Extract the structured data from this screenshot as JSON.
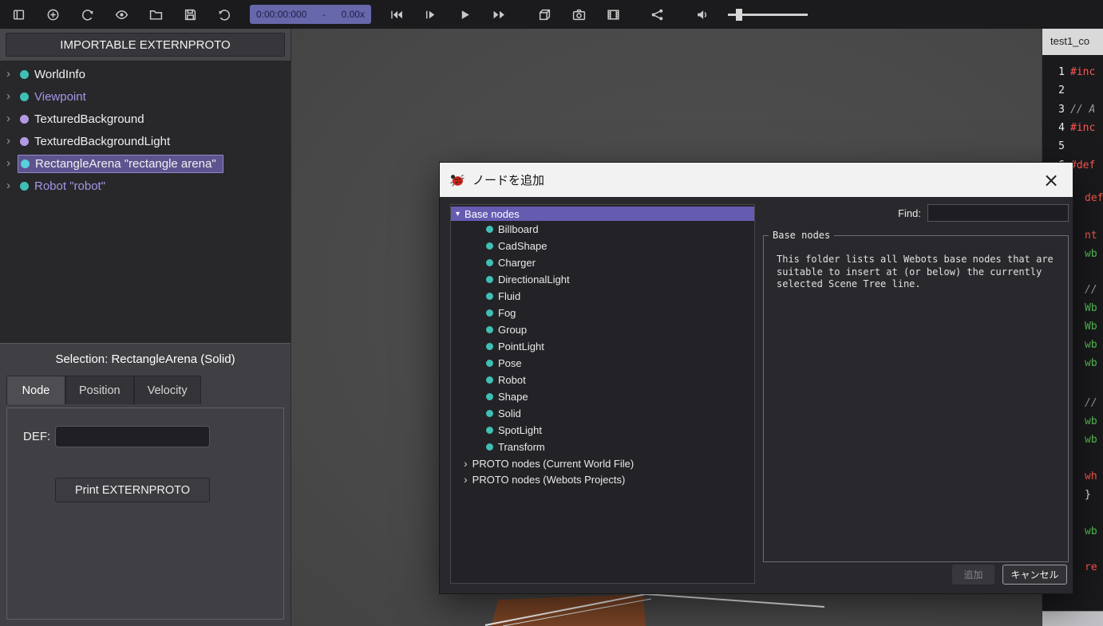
{
  "toolbar": {
    "time_value": "0:00:00:000",
    "time_separator": "-",
    "speed_value": "0.00x"
  },
  "icons": {
    "chevron_right": "›",
    "chevron_down": "▾",
    "close": "×"
  },
  "scene_tree": {
    "header_button": "IMPORTABLE EXTERNPROTO",
    "items": [
      {
        "label": "WorldInfo"
      },
      {
        "label": "Viewpoint"
      },
      {
        "label": "TexturedBackground"
      },
      {
        "label": "TexturedBackgroundLight"
      },
      {
        "label": "RectangleArena \"rectangle arena\""
      },
      {
        "label": "Robot \"robot\""
      }
    ]
  },
  "selection_panel": {
    "title": "Selection: RectangleArena (Solid)",
    "tabs": [
      {
        "label": "Node"
      },
      {
        "label": "Position"
      },
      {
        "label": "Velocity"
      }
    ],
    "def_label": "DEF:",
    "def_value": "",
    "print_button": "Print EXTERNPROTO"
  },
  "add_node_dialog": {
    "title": "ノードを追加",
    "tree": {
      "root_label": "Base nodes",
      "base_nodes": [
        {
          "label": "Billboard"
        },
        {
          "label": "CadShape"
        },
        {
          "label": "Charger"
        },
        {
          "label": "DirectionalLight"
        },
        {
          "label": "Fluid"
        },
        {
          "label": "Fog"
        },
        {
          "label": "Group"
        },
        {
          "label": "PointLight"
        },
        {
          "label": "Pose"
        },
        {
          "label": "Robot"
        },
        {
          "label": "Shape"
        },
        {
          "label": "Solid"
        },
        {
          "label": "SpotLight"
        },
        {
          "label": "Transform"
        }
      ],
      "proto_groups": [
        {
          "label": "PROTO nodes (Current World File)"
        },
        {
          "label": "PROTO nodes (Webots Projects)"
        }
      ]
    },
    "find_label": "Find:",
    "find_value": "",
    "info_box": {
      "title": "Base nodes",
      "text": "This folder lists all Webots base nodes that are suitable to insert at (or below) the currently selected Scene Tree line."
    },
    "add_button": "追加",
    "cancel_button": "キャンセル"
  },
  "editor": {
    "tab_label": "test1_co",
    "lines": [
      {
        "num": "1",
        "code": "#inc"
      },
      {
        "num": "2",
        "code": ""
      },
      {
        "num": "3",
        "code": "// A"
      },
      {
        "num": "4",
        "code": "#inc"
      },
      {
        "num": "5",
        "code": ""
      },
      {
        "num": "6",
        "code": "#def"
      }
    ],
    "fragments": [
      {
        "text": "def"
      },
      {
        "text": "nt"
      },
      {
        "text": "wb"
      },
      {
        "text": "//"
      },
      {
        "text": "Wb"
      },
      {
        "text": "Wb"
      },
      {
        "text": "wb"
      },
      {
        "text": "wb"
      },
      {
        "text": "//"
      },
      {
        "text": "wb"
      },
      {
        "text": "wb"
      },
      {
        "text": "wh"
      },
      {
        "text": "}"
      },
      {
        "text": "wb"
      },
      {
        "text": "re"
      }
    ]
  },
  "colors": {
    "selection_purple": "#5d548f",
    "dialog_highlight_purple": "#655cb2",
    "teal_node_dot": "#3fc0b4",
    "pink_node_dot": "#b49ae4",
    "purple_tree_text": "#a795e8",
    "time_box_blue": "#6767ab",
    "code_red": "#ff584c",
    "code_green": "#56c453",
    "code_gray": "#9a9aa2"
  }
}
